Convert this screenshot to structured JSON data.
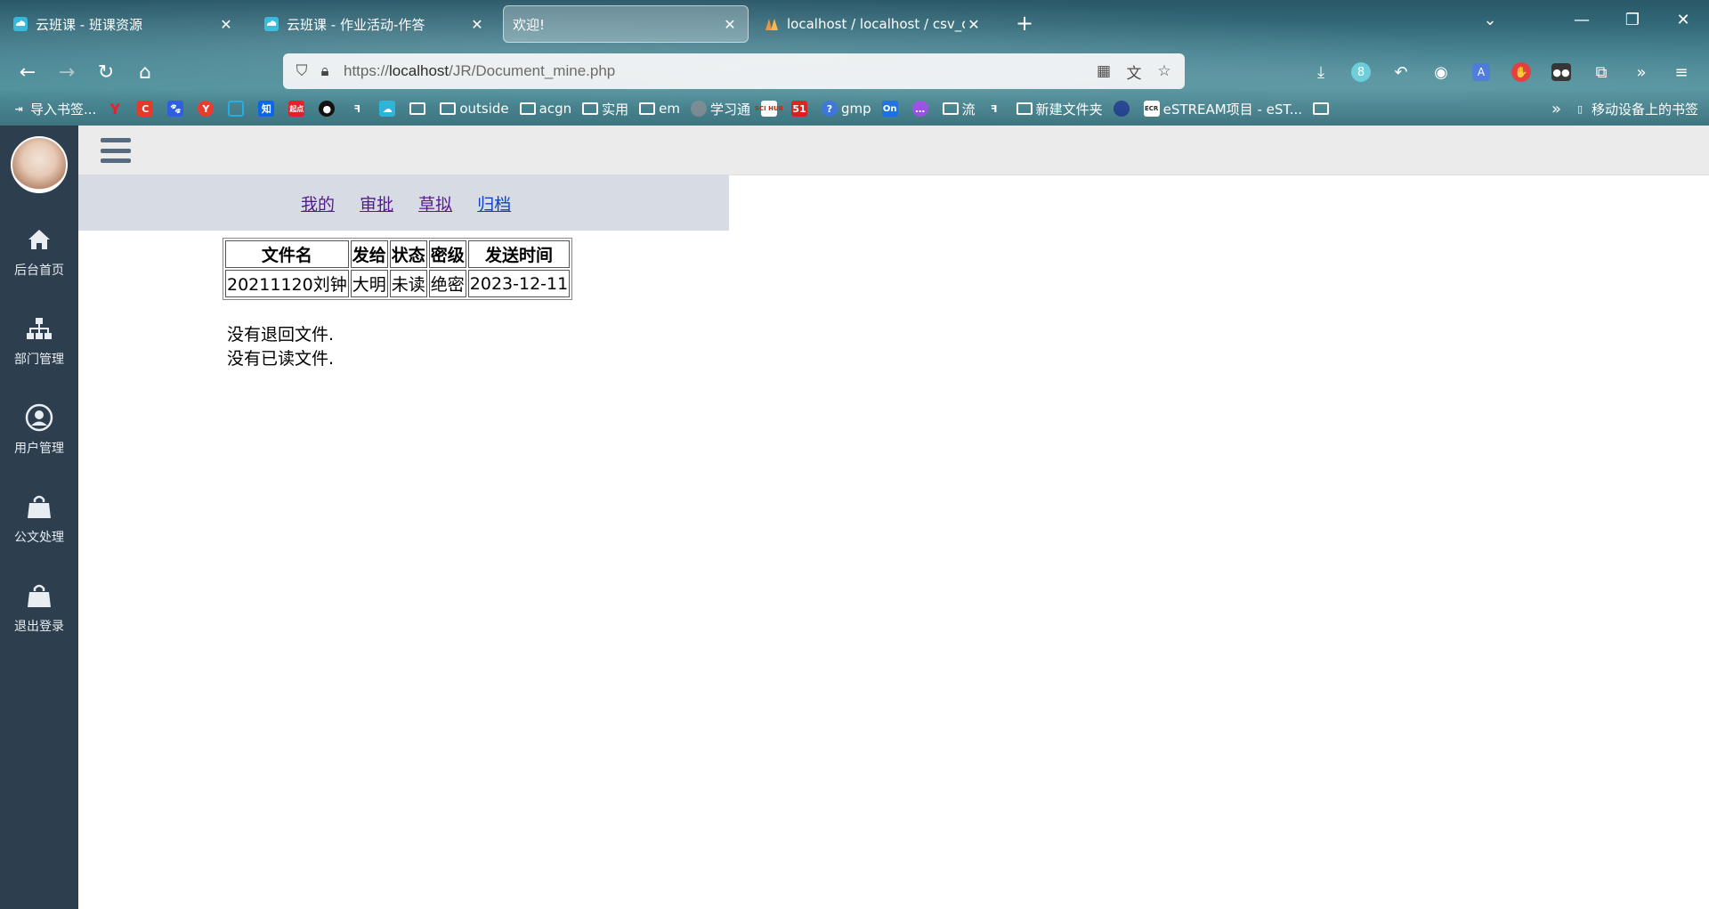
{
  "browser": {
    "tabs": [
      {
        "title": "云班课 - 班课资源",
        "active": false
      },
      {
        "title": "云班课 - 作业活动-作答",
        "active": false
      },
      {
        "title": "欢迎!",
        "active": true
      },
      {
        "title": "localhost / localhost / csv_db",
        "active": false
      }
    ],
    "url_prefix": "https://",
    "url_host": "localhost",
    "url_path": "/JR/Document_mine.php",
    "badge_count": "8",
    "bookmarks": [
      {
        "label": "导入书签...",
        "icon": "import-icon"
      },
      {
        "label": "",
        "icon": "yandex-icon"
      },
      {
        "label": "",
        "icon": "c-icon"
      },
      {
        "label": "",
        "icon": "baidu-icon"
      },
      {
        "label": "",
        "icon": "y-icon"
      },
      {
        "label": "",
        "icon": "bilibili-icon"
      },
      {
        "label": "",
        "icon": "zhihu-icon"
      },
      {
        "label": "",
        "icon": "qidian-icon"
      },
      {
        "label": "",
        "icon": "github-icon"
      },
      {
        "label": "",
        "icon": "script-icon"
      },
      {
        "label": "",
        "icon": "cloud-icon"
      },
      {
        "label": "",
        "icon": "folder-icon"
      },
      {
        "label": "outside",
        "icon": "folder-icon"
      },
      {
        "label": "acgn",
        "icon": "folder-icon"
      },
      {
        "label": "实用",
        "icon": "folder-icon"
      },
      {
        "label": "em",
        "icon": "folder-icon"
      },
      {
        "label": "学习通",
        "icon": "globe-icon"
      },
      {
        "label": "",
        "icon": "scihub-icon"
      },
      {
        "label": "",
        "icon": "51-icon"
      },
      {
        "label": "gmp",
        "icon": "help-icon"
      },
      {
        "label": "",
        "icon": "on-icon"
      },
      {
        "label": "",
        "icon": "chat-icon"
      },
      {
        "label": "流",
        "icon": "folder-icon"
      },
      {
        "label": "",
        "icon": "script-icon"
      },
      {
        "label": "新建文件夹",
        "icon": "folder-icon"
      },
      {
        "label": "",
        "icon": "globe-icon"
      },
      {
        "label": "eSTREAM项目 - eST...",
        "icon": "ecr-icon"
      },
      {
        "label": "",
        "icon": "folder-icon"
      }
    ],
    "mobile_bookmarks": "移动设备上的书签"
  },
  "sidebar": {
    "items": [
      {
        "label": "后台首页",
        "icon": "home-icon"
      },
      {
        "label": "部门管理",
        "icon": "sitemap-icon"
      },
      {
        "label": "用户管理",
        "icon": "user-icon"
      },
      {
        "label": "公文处理",
        "icon": "bag-icon"
      },
      {
        "label": "退出登录",
        "icon": "bag-icon"
      }
    ]
  },
  "subnav": {
    "links": [
      "我的",
      "审批",
      "草拟",
      "归档"
    ]
  },
  "table": {
    "headers": [
      "文件名",
      "发给",
      "状态",
      "密级",
      "发送时间"
    ],
    "rows": [
      [
        "20211120刘钟",
        "大明",
        "未读",
        "绝密",
        "2023-12-11"
      ]
    ]
  },
  "messages": {
    "returned": "没有退回文件.",
    "read": "没有已读文件."
  },
  "colors": {
    "sidebar_bg": "#2d3e4f",
    "topbar_bg": "#ebebeb",
    "subnav_bg": "#d7dce4",
    "visited_link": "#551a8b",
    "link": "#0b40c8"
  }
}
